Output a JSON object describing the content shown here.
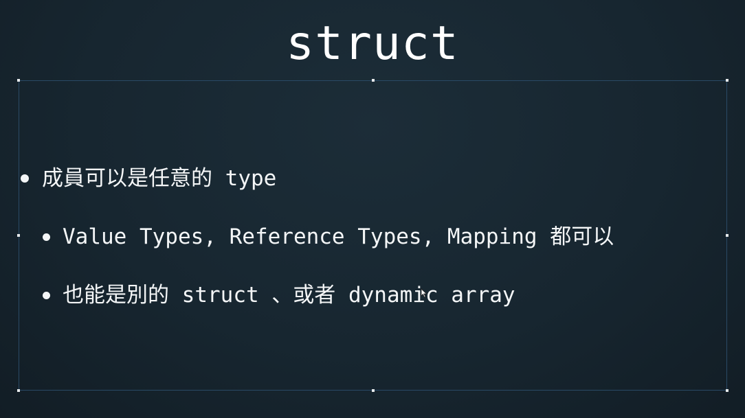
{
  "slide": {
    "title": "struct",
    "bullets": [
      {
        "text": "成員可以是任意的 type"
      },
      {
        "text": "Value Types, Reference Types, Mapping 都可以"
      },
      {
        "text": "也能是別的 struct 、或者 dynamic array"
      }
    ]
  },
  "colors": {
    "background": "#172630",
    "text": "#f4f6f7",
    "textbox_border": "#2a4a66"
  },
  "icons": {
    "pointer": "mouse-cursor-icon",
    "selection_handle": "resize-handle-icon"
  }
}
